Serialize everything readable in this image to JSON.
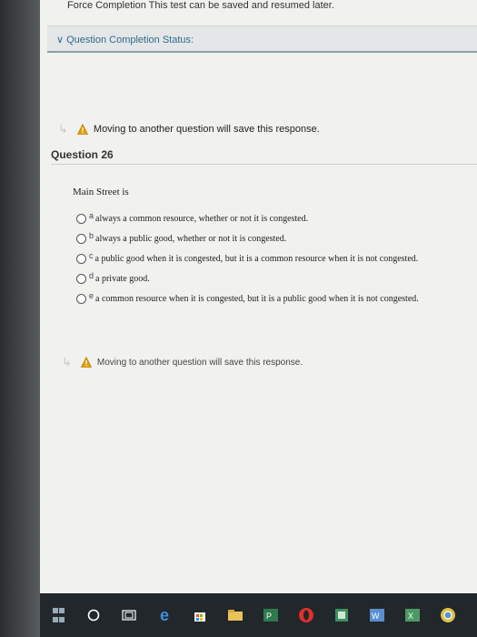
{
  "header": {
    "force_completion": "Force Completion  This test can be saved and resumed later.",
    "completion_status": "Question Completion Status:"
  },
  "warnings": {
    "top": "Moving to another question will save this response.",
    "bottom": "Moving to another question will save this response."
  },
  "question": {
    "title": "Question 26",
    "prompt": "Main Street is",
    "options": [
      {
        "letter": "a",
        "text": "always a common resource, whether or not it is congested."
      },
      {
        "letter": "b",
        "text": "always a public good, whether or not it is congested."
      },
      {
        "letter": "c",
        "text": "a public good when it is congested, but it is a common resource when it is not congested."
      },
      {
        "letter": "d",
        "text": "a private good."
      },
      {
        "letter": "e",
        "text": "a common resource when it is congested, but it is a public good when it is not congested."
      }
    ]
  },
  "taskbar": {
    "icons": [
      "windows-start-icon",
      "search-circle-icon",
      "task-view-icon",
      "edge-browser-icon",
      "store-icon",
      "file-explorer-icon",
      "powerpoint-icon",
      "opera-icon",
      "app-icon",
      "word-icon",
      "excel-icon",
      "chrome-icon"
    ]
  },
  "colors": {
    "status_text": "#2e6b8f",
    "warning": "#d9a400",
    "taskbar": "#22272b"
  }
}
